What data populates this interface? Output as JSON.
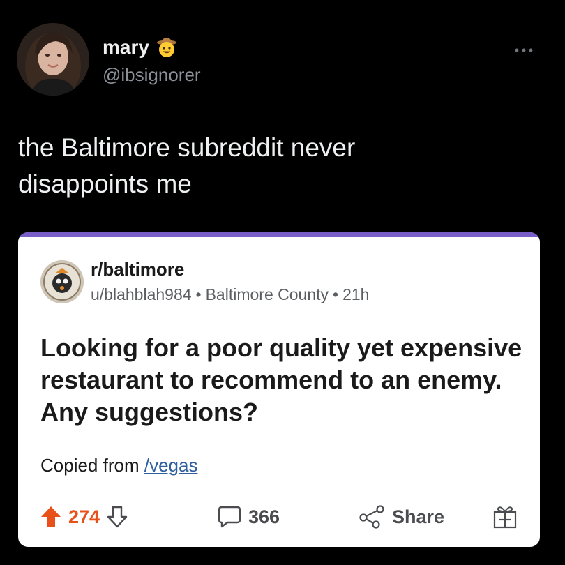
{
  "tweet": {
    "display_name": "mary",
    "name_emoji": "cowboy-face-emoji",
    "handle": "@ibsignorer",
    "more_icon": "more-horizontal-icon",
    "text_line1": "the Baltimore subreddit never",
    "text_line2": "disappoints me"
  },
  "reddit_post": {
    "subreddit": "r/baltimore",
    "author": "u/blahblah984",
    "location": "Baltimore County",
    "age": "21h",
    "meta_separator": "•",
    "title": "Looking for a poor quality yet expensive restaurant to recommend to an enemy. Any suggestions?",
    "copied_prefix": "Copied from",
    "copied_link": "/vegas",
    "upvotes": "274",
    "comments": "366",
    "share_label": "Share",
    "colors": {
      "accent_bar": "#7a5ec8",
      "upvote": "#e8521a",
      "link": "#2f5f9e"
    }
  }
}
